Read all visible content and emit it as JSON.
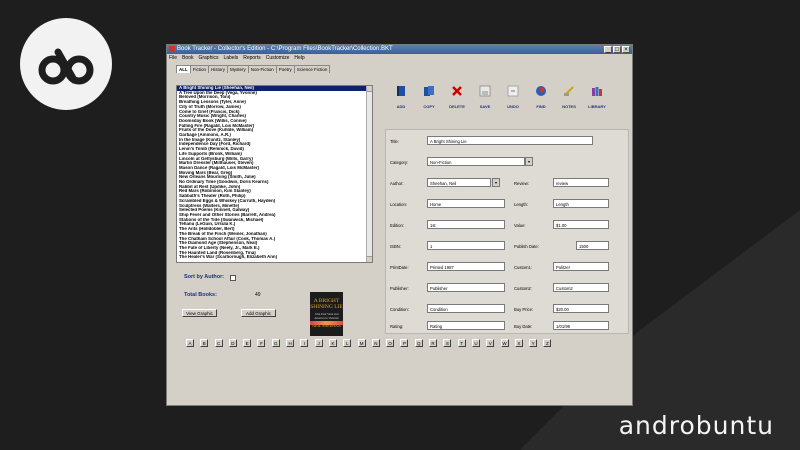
{
  "window": {
    "title": "Book Tracker - Collector's Edition - C:\\Program Files\\BookTracker\\Collection.BKT",
    "menu": [
      "File",
      "Book",
      "Graphics",
      "Labels",
      "Reports",
      "Customize",
      "Help"
    ],
    "tabs": [
      "ALL",
      "Fiction",
      "History",
      "Mystery",
      "Non-Fiction",
      "Poetry",
      "Science Fiction"
    ]
  },
  "books": [
    "A Bright Shining Lie (Sheehan, Neil)",
    "A Tree Upon the Deep (Vega, Yvonne)",
    "Beloved (Morrison, Toni)",
    "Breathing Lessons (Tyler, Anne)",
    "City of Truth (Morrow, James)",
    "Come to Grief (Francis, Dick)",
    "Country Music (Wright, Charles)",
    "Doomsday Book (Willis, Connie)",
    "Falling Fire (Ragald, Lois McMaster)",
    "Fruits of the Dove (Kuhlde, William)",
    "Garbage (Ammons, A.R.)",
    "In the Image (Kunitz, Stanley)",
    "Independence Day (Ford, Richard)",
    "Lenin's Tomb (Remnick, David)",
    "Life Supports (Bronk, William)",
    "Lincoln at Gettysburg (Wills, Garry)",
    "Martin Dressler (Millhauser, Steven)",
    "Mason Dance (Ragald, Lois McMaster)",
    "Moving Mars (Bear, Greg)",
    "New Orleans Mourning (Smith, Julie)",
    "No Ordinary Time (Goodwin, Doris Kearns)",
    "Rabbit at Rest (Updike, John)",
    "Red Mars (Robinson, Kim Stanley)",
    "Sabbath's Theater (Roth, Philip)",
    "Scrambled Eggs & Whiskey (Carruth, Hayden)",
    "Sculptress (Walters, Minette)",
    "Selected Poems (Kinnell, Galway)",
    "Ship Fever and Other Stories (Barrett, Andrea)",
    "Stations of the Tide (Swanwick, Michael)",
    "Tehanu (LeGuin, Ursula K.)",
    "The Ants (Holldobler, Bert)",
    "The Break of the Finch (Weiner, Jonathan)",
    "The Chatham School Affair (Cook, Thomas A.)",
    "The Diamond Age (Stephenson, Neal)",
    "The Fate of Liberty (Neely, Jr., Mark E.)",
    "The Haunted Land (Rosenberg, Tina)",
    "The Healer's War (Scarborough, Elizabeth Ann)"
  ],
  "sort_by_author_label": "Sort by Author:",
  "total_books_label": "Total Books:",
  "total_books_value": "49",
  "view_graphic_label": "View Graphic",
  "add_graphic_label": "Add Graphic",
  "cover": {
    "title": "A BRIGHT SHINING LIE",
    "subtitle": "John Paul Vann and America in Vietnam",
    "author": "NEIL SHEEHAN"
  },
  "toolbar": [
    "ADD",
    "COPY",
    "DELETE",
    "SAVE",
    "UNDO",
    "FIND",
    "NOTES",
    "LIBRARY"
  ],
  "form": {
    "title_label": "Title:",
    "title_value": "A Bright Shining Lie",
    "category_label": "Category:",
    "category_value": "Non-Fiction",
    "author_label": "Author:",
    "author_value": "Sheehan, Neil",
    "review_label": "Review:",
    "review_value": "review",
    "location_label": "Location:",
    "location_value": "Home",
    "length_label": "Length:",
    "length_value": "Length",
    "edition_label": "Edition:",
    "edition_value": "1st",
    "value_label": "Value:",
    "value_value": "$1.00",
    "isbn_label": "ISBN:",
    "isbn_value": "1",
    "publish_date_label": "Publish Date:",
    "publish_date_value": "1500",
    "print_date_label": "PrintDate:",
    "print_date_value": "Printed 1987",
    "custom1_label": "Custom1:",
    "custom1_value": "Pulitzer",
    "publisher_label": "Publisher:",
    "publisher_value": "Publisher",
    "custom2_label": "Custom2:",
    "custom2_value": "Custom2",
    "condition_label": "Condition:",
    "condition_value": "Condition",
    "buy_price_label": "Buy Price:",
    "buy_price_value": "$20.00",
    "rating_label": "Rating:",
    "rating_value": "Rating",
    "buy_date_label": "Buy Date:",
    "buy_date_value": "1/01/99"
  },
  "letters": [
    "A",
    "B",
    "C",
    "D",
    "E",
    "F",
    "G",
    "H",
    "I",
    "J",
    "K",
    "L",
    "M",
    "N",
    "O",
    "P",
    "Q",
    "R",
    "S",
    "T",
    "U",
    "V",
    "W",
    "X",
    "Y",
    "Z"
  ],
  "watermark": "androbuntu"
}
